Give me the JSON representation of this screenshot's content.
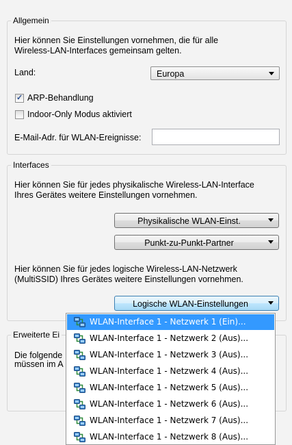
{
  "general": {
    "legend": "Allgemein",
    "description_line1": "Hier können Sie Einstellungen vornehmen, die für alle",
    "description_line2": "Wireless-LAN-Interfaces gemeinsam gelten.",
    "country_label": "Land:",
    "country_value": "Europa",
    "arp_label": "ARP-Behandlung",
    "arp_checked": true,
    "indoor_label": "Indoor-Only Modus aktiviert",
    "indoor_checked": false,
    "email_label": "E-Mail-Adr. für WLAN-Ereignisse:",
    "email_value": ""
  },
  "interfaces": {
    "legend": "Interfaces",
    "physical_desc_line1": "Hier können Sie für jedes physikalische Wireless-LAN-Interface",
    "physical_desc_line2": "Ihres Gerätes weitere Einstellungen vornehmen.",
    "physical_button": "Physikalische WLAN-Einst.",
    "p2p_button": "Punkt-zu-Punkt-Partner",
    "logical_desc_line1": "Hier können Sie für jedes logische Wireless-LAN-Netzwerk",
    "logical_desc_line2": "(MultiSSID) Ihres Gerätes weitere Einstellungen vornehmen.",
    "logical_button": "Logische WLAN-Einstellungen"
  },
  "advanced": {
    "legend": "Erweiterte Ei",
    "desc_line1": "Die folgende",
    "desc_line2": "müssen im A"
  },
  "dropdown": {
    "items": [
      "WLAN-Interface 1 - Netzwerk 1 (Ein)...",
      "WLAN-Interface 1 - Netzwerk 2 (Aus)...",
      "WLAN-Interface 1 - Netzwerk 3 (Aus)...",
      "WLAN-Interface 1 - Netzwerk 4 (Aus)...",
      "WLAN-Interface 1 - Netzwerk 5 (Aus)...",
      "WLAN-Interface 1 - Netzwerk 6 (Aus)...",
      "WLAN-Interface 1 - Netzwerk 7 (Aus)...",
      "WLAN-Interface 1 - Netzwerk 8 (Aus)..."
    ],
    "selected_index": 0,
    "item_icon": "network-icon"
  },
  "colors": {
    "selection": "#3399ff",
    "group_border": "#d5d5d5",
    "background": "#f3f3f3"
  }
}
